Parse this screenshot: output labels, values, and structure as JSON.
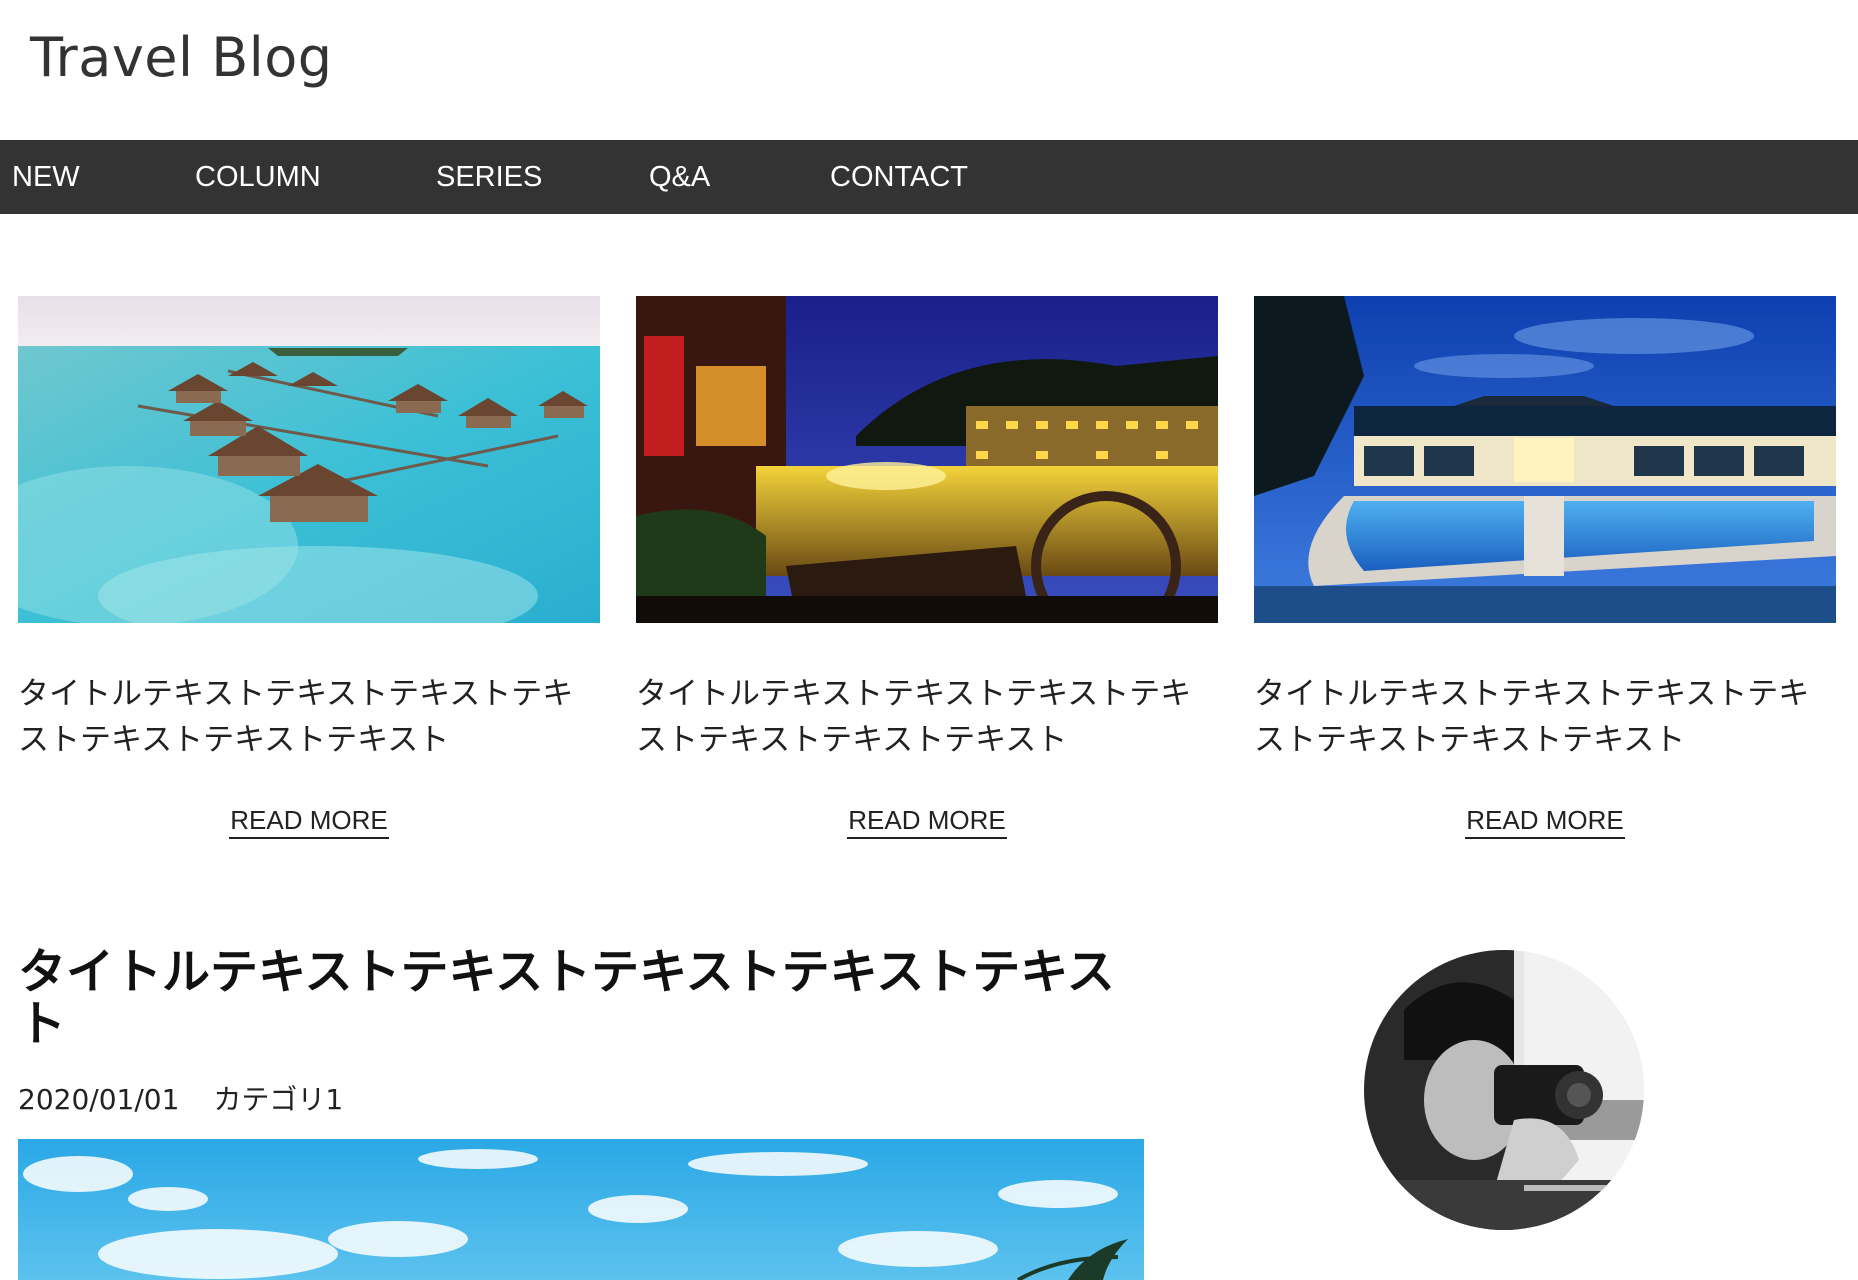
{
  "site": {
    "title": "Travel Blog"
  },
  "nav": {
    "items": [
      {
        "label": "NEW"
      },
      {
        "label": "COLUMN"
      },
      {
        "label": "SERIES"
      },
      {
        "label": "Q&A"
      },
      {
        "label": "CONTACT"
      }
    ]
  },
  "cards": [
    {
      "title": "タイトルテキストテキストテキストテキストテキストテキストテキスト",
      "link_label": "READ MORE"
    },
    {
      "title": "タイトルテキストテキストテキストテキストテキストテキストテキスト",
      "link_label": "READ MORE"
    },
    {
      "title": "タイトルテキストテキストテキストテキストテキストテキストテキスト",
      "link_label": "READ MORE"
    }
  ],
  "post": {
    "title": "タイトルテキストテキストテキストテキストテキスト",
    "date": "2020/01/01",
    "category": "カテゴリ1"
  },
  "colors": {
    "nav_background": "#333333",
    "nav_text": "#ffffff",
    "text": "#222222"
  }
}
